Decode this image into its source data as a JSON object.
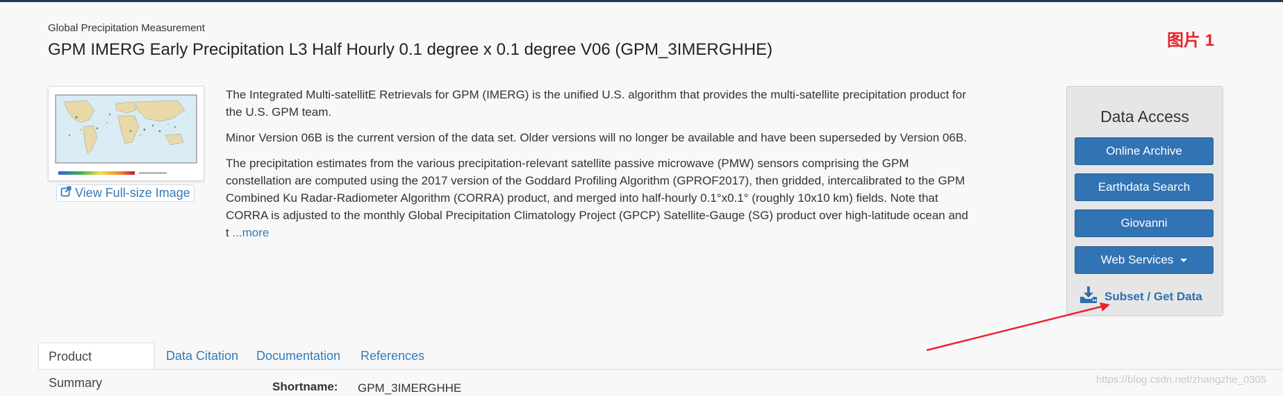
{
  "header": {
    "mission": "Global Precipitation Measurement",
    "title": "GPM IMERG Early Precipitation L3 Half Hourly 0.1 degree x 0.1 degree V06 (GPM_3IMERGHHE)"
  },
  "annotation": {
    "label": "图片 1",
    "color": "#e8232a"
  },
  "thumbnail": {
    "link_label": "View Full-size Image",
    "link_icon": "external-link-icon"
  },
  "description": {
    "paragraphs": [
      "The Integrated Multi-satellitE Retrievals for GPM (IMERG) is the unified U.S. algorithm that provides the multi-satellite precipitation product for the U.S. GPM team.",
      "Minor Version 06B is the current version of the data set. Older versions will no longer be available and have been superseded by Version 06B.",
      "The precipitation estimates from the various precipitation-relevant satellite passive microwave (PMW) sensors comprising the GPM constellation are computed using the 2017 version of the Goddard Profiling Algorithm (GPROF2017), then gridded, intercalibrated to the GPM Combined Ku Radar-Radiometer Algorithm (CORRA) product, and merged into half-hourly 0.1°x0.1° (roughly 10x10 km) fields. Note that CORRA is adjusted to the monthly Global Precipitation Climatology Project (GPCP) Satellite-Gauge (SG) product over high-latitude ocean and t"
    ],
    "more_label": "...more"
  },
  "data_access": {
    "title": "Data Access",
    "buttons": [
      "Online Archive",
      "Earthdata Search",
      "Giovanni",
      "Web Services"
    ],
    "subset_label": "Subset / Get Data",
    "subset_icon": "download-icon",
    "accent": "#3173b3"
  },
  "tabs": [
    "Product Summary",
    "Data Citation",
    "Documentation",
    "References"
  ],
  "summary": {
    "shortname_label": "Shortname:",
    "shortname_value": "GPM_3IMERGHHE"
  },
  "watermark": "https://blog.csdn.net/zhangzhe_0305"
}
